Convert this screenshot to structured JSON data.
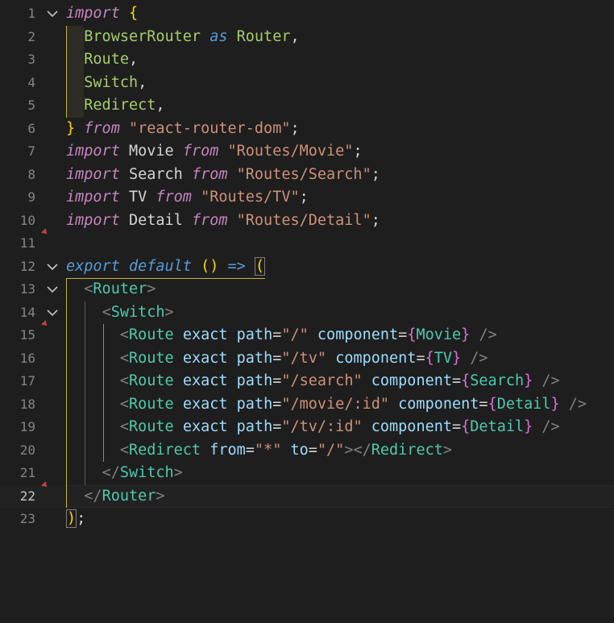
{
  "editor": {
    "language": "javascript-react",
    "current_line": 22,
    "line_numbers": [
      "1",
      "2",
      "3",
      "4",
      "5",
      "6",
      "7",
      "8",
      "9",
      "10",
      "11",
      "12",
      "13",
      "14",
      "15",
      "16",
      "17",
      "18",
      "19",
      "20",
      "21",
      "22",
      "23"
    ],
    "tokens": {
      "import": "import",
      "open_brace": "{",
      "close_brace": "}",
      "browser_router": "BrowserRouter",
      "as": "as",
      "router_alias": "Router",
      "comma": ",",
      "route": "Route",
      "switch": "Switch",
      "redirect": "Redirect",
      "from": "from",
      "react_router_dom": "\"react-router-dom\"",
      "semicolon": ";",
      "movie": "Movie",
      "search": "Search",
      "tv": "TV",
      "detail": "Detail",
      "path_movie": "\"Routes/Movie\"",
      "path_search": "\"Routes/Search\"",
      "path_tv": "\"Routes/TV\"",
      "path_detail": "\"Routes/Detail\"",
      "export": "export",
      "default": "default",
      "parens": "()",
      "arrow": "=>",
      "open_paren": "(",
      "close_paren": ")",
      "lt": "<",
      "gt": ">",
      "lt_slash": "</",
      "self_close": "/>",
      "router_tag": "Router",
      "switch_tag": "Switch",
      "route_tag": "Route",
      "redirect_tag": "Redirect",
      "exact": "exact",
      "path_attr": "path",
      "component_attr": "component",
      "from_attr": "from",
      "to_attr": "to",
      "eq": "=",
      "v_root": "\"/\"",
      "v_tv": "\"/tv\"",
      "v_search": "\"/search\"",
      "v_movie_id": "\"/movie/:id\"",
      "v_tv_id": "\"/tv/:id\"",
      "v_star": "\"*\"",
      "comp_movie": "Movie",
      "comp_tv": "TV",
      "comp_search": "Search",
      "comp_detail": "Detail"
    },
    "colors": {
      "background": "#1e1e1e",
      "keyword_import": "#c586c0",
      "keyword_blue": "#569cd6",
      "string": "#ce9178",
      "bracket_gold": "#ffd700",
      "jsx_tag": "#4ec9b0",
      "attribute": "#9cdcfe"
    }
  }
}
